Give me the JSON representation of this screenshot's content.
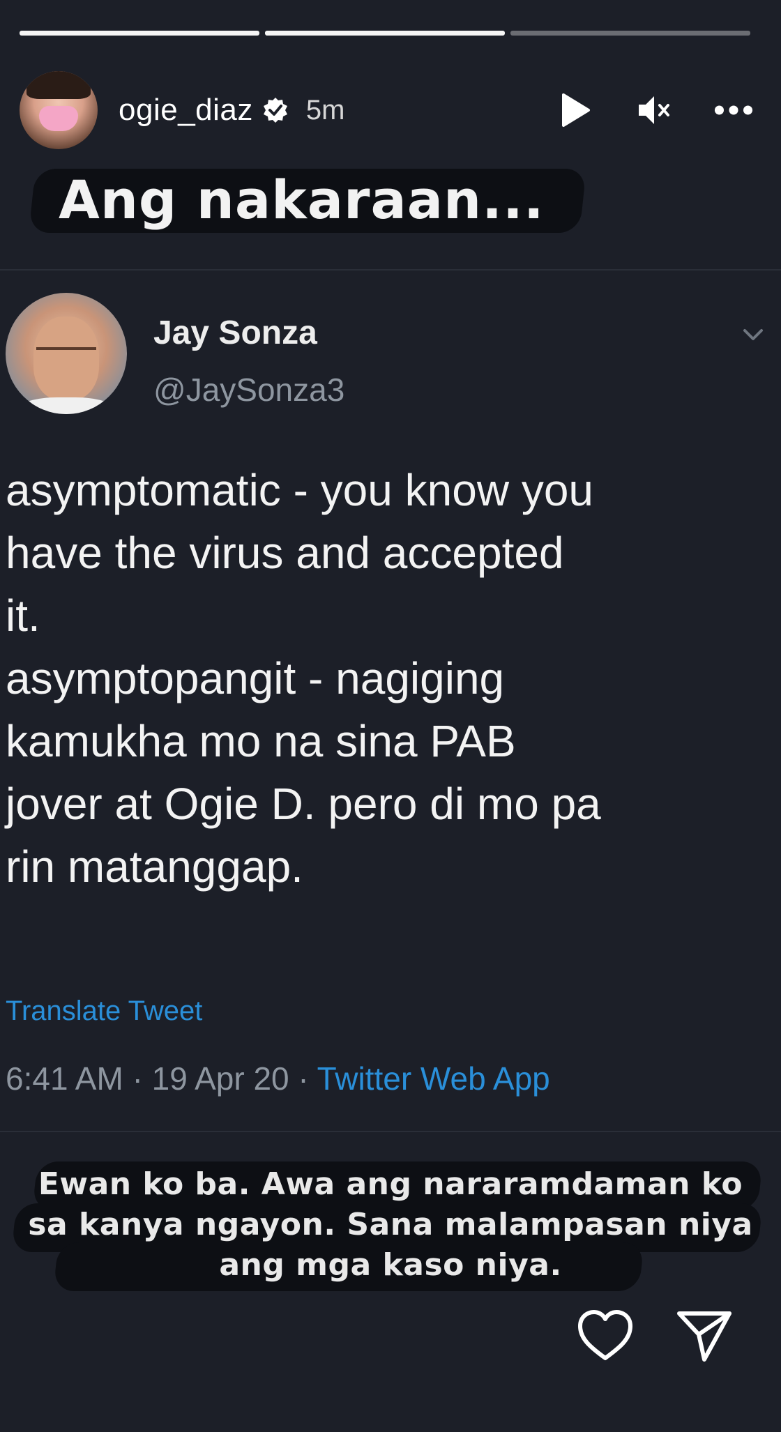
{
  "story": {
    "progress": [
      1.0,
      1.0,
      0.0
    ],
    "username": "ogie_diaz",
    "time_ago": "5m",
    "caption_top": "Ang nakaraan...",
    "caption_bottom": "Ewan ko ba. Awa ang nararamdaman ko\nsa kanya ngayon. Sana malampasan niya\nang mga kaso niya."
  },
  "icons": {
    "verified": "verified-badge-icon",
    "play": "play-icon",
    "mute": "mute-icon",
    "more": "more-icon",
    "chevron": "chevron-down-icon",
    "like": "heart-icon",
    "share": "send-icon"
  },
  "tweet": {
    "name": "Jay Sonza",
    "handle": "@JaySonza3",
    "body": "asymptomatic - you know you\nhave the virus and accepted\nit.\nasymptopangit - nagiging\nkamukha mo na sina PAB\njover at Ogie D. pero di mo pa\nrin matanggap.",
    "translate_label": "Translate Tweet",
    "time": "6:41 AM",
    "date": "19 Apr 20",
    "separator": "·",
    "source": "Twitter Web App"
  },
  "colors": {
    "background": "#1c1f28",
    "link": "#2a8fd9",
    "muted": "#8e96a0"
  }
}
